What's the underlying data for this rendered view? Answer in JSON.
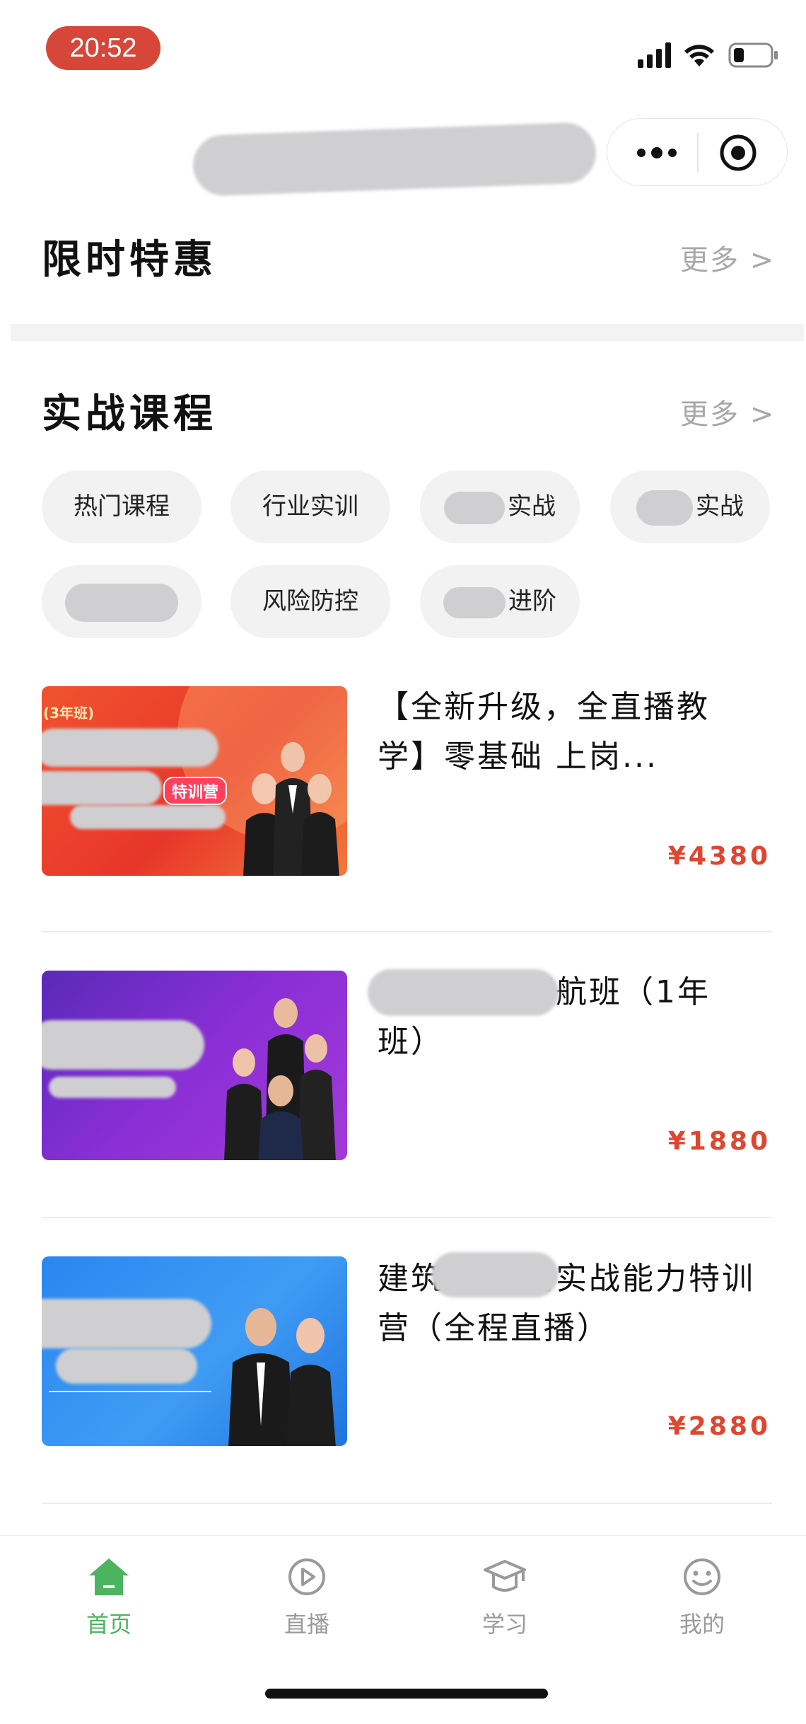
{
  "status_bar": {
    "time": "20:52"
  },
  "capsule": {
    "more_icon": "more-dots-icon",
    "close_icon": "target-circle-icon"
  },
  "sections": {
    "limited_offer": {
      "title": "限时特惠",
      "more": "更多 >"
    },
    "courses": {
      "title": "实战课程",
      "more": "更多 >"
    }
  },
  "chips": [
    "热门课程",
    "行业实训",
    "实战",
    "实战",
    "",
    "风险防控",
    "进阶"
  ],
  "course_list": [
    {
      "title": "【全新升级，全直播教学】零基础    上岗...",
      "price": "¥4380",
      "thumb_tag": "(3年班)",
      "thumb_badge": "特训营",
      "theme": "#e8432e"
    },
    {
      "title": "建筑    实战领航班（1年班）",
      "price": "¥1880",
      "theme": "#7a2fc4"
    },
    {
      "title": "建筑业    上岗实战能力特训营（全程直播）",
      "price": "¥2880",
      "theme": "#2d8df0"
    }
  ],
  "tabs": [
    {
      "label": "首页",
      "icon": "home-icon"
    },
    {
      "label": "直播",
      "icon": "play-circle-icon"
    },
    {
      "label": "学习",
      "icon": "graduation-cap-icon"
    },
    {
      "label": "我的",
      "icon": "smiley-face-icon"
    }
  ],
  "colors": {
    "accent_green": "#4cb45e",
    "price_red": "#e0452f",
    "time_pill": "#d6473a"
  }
}
